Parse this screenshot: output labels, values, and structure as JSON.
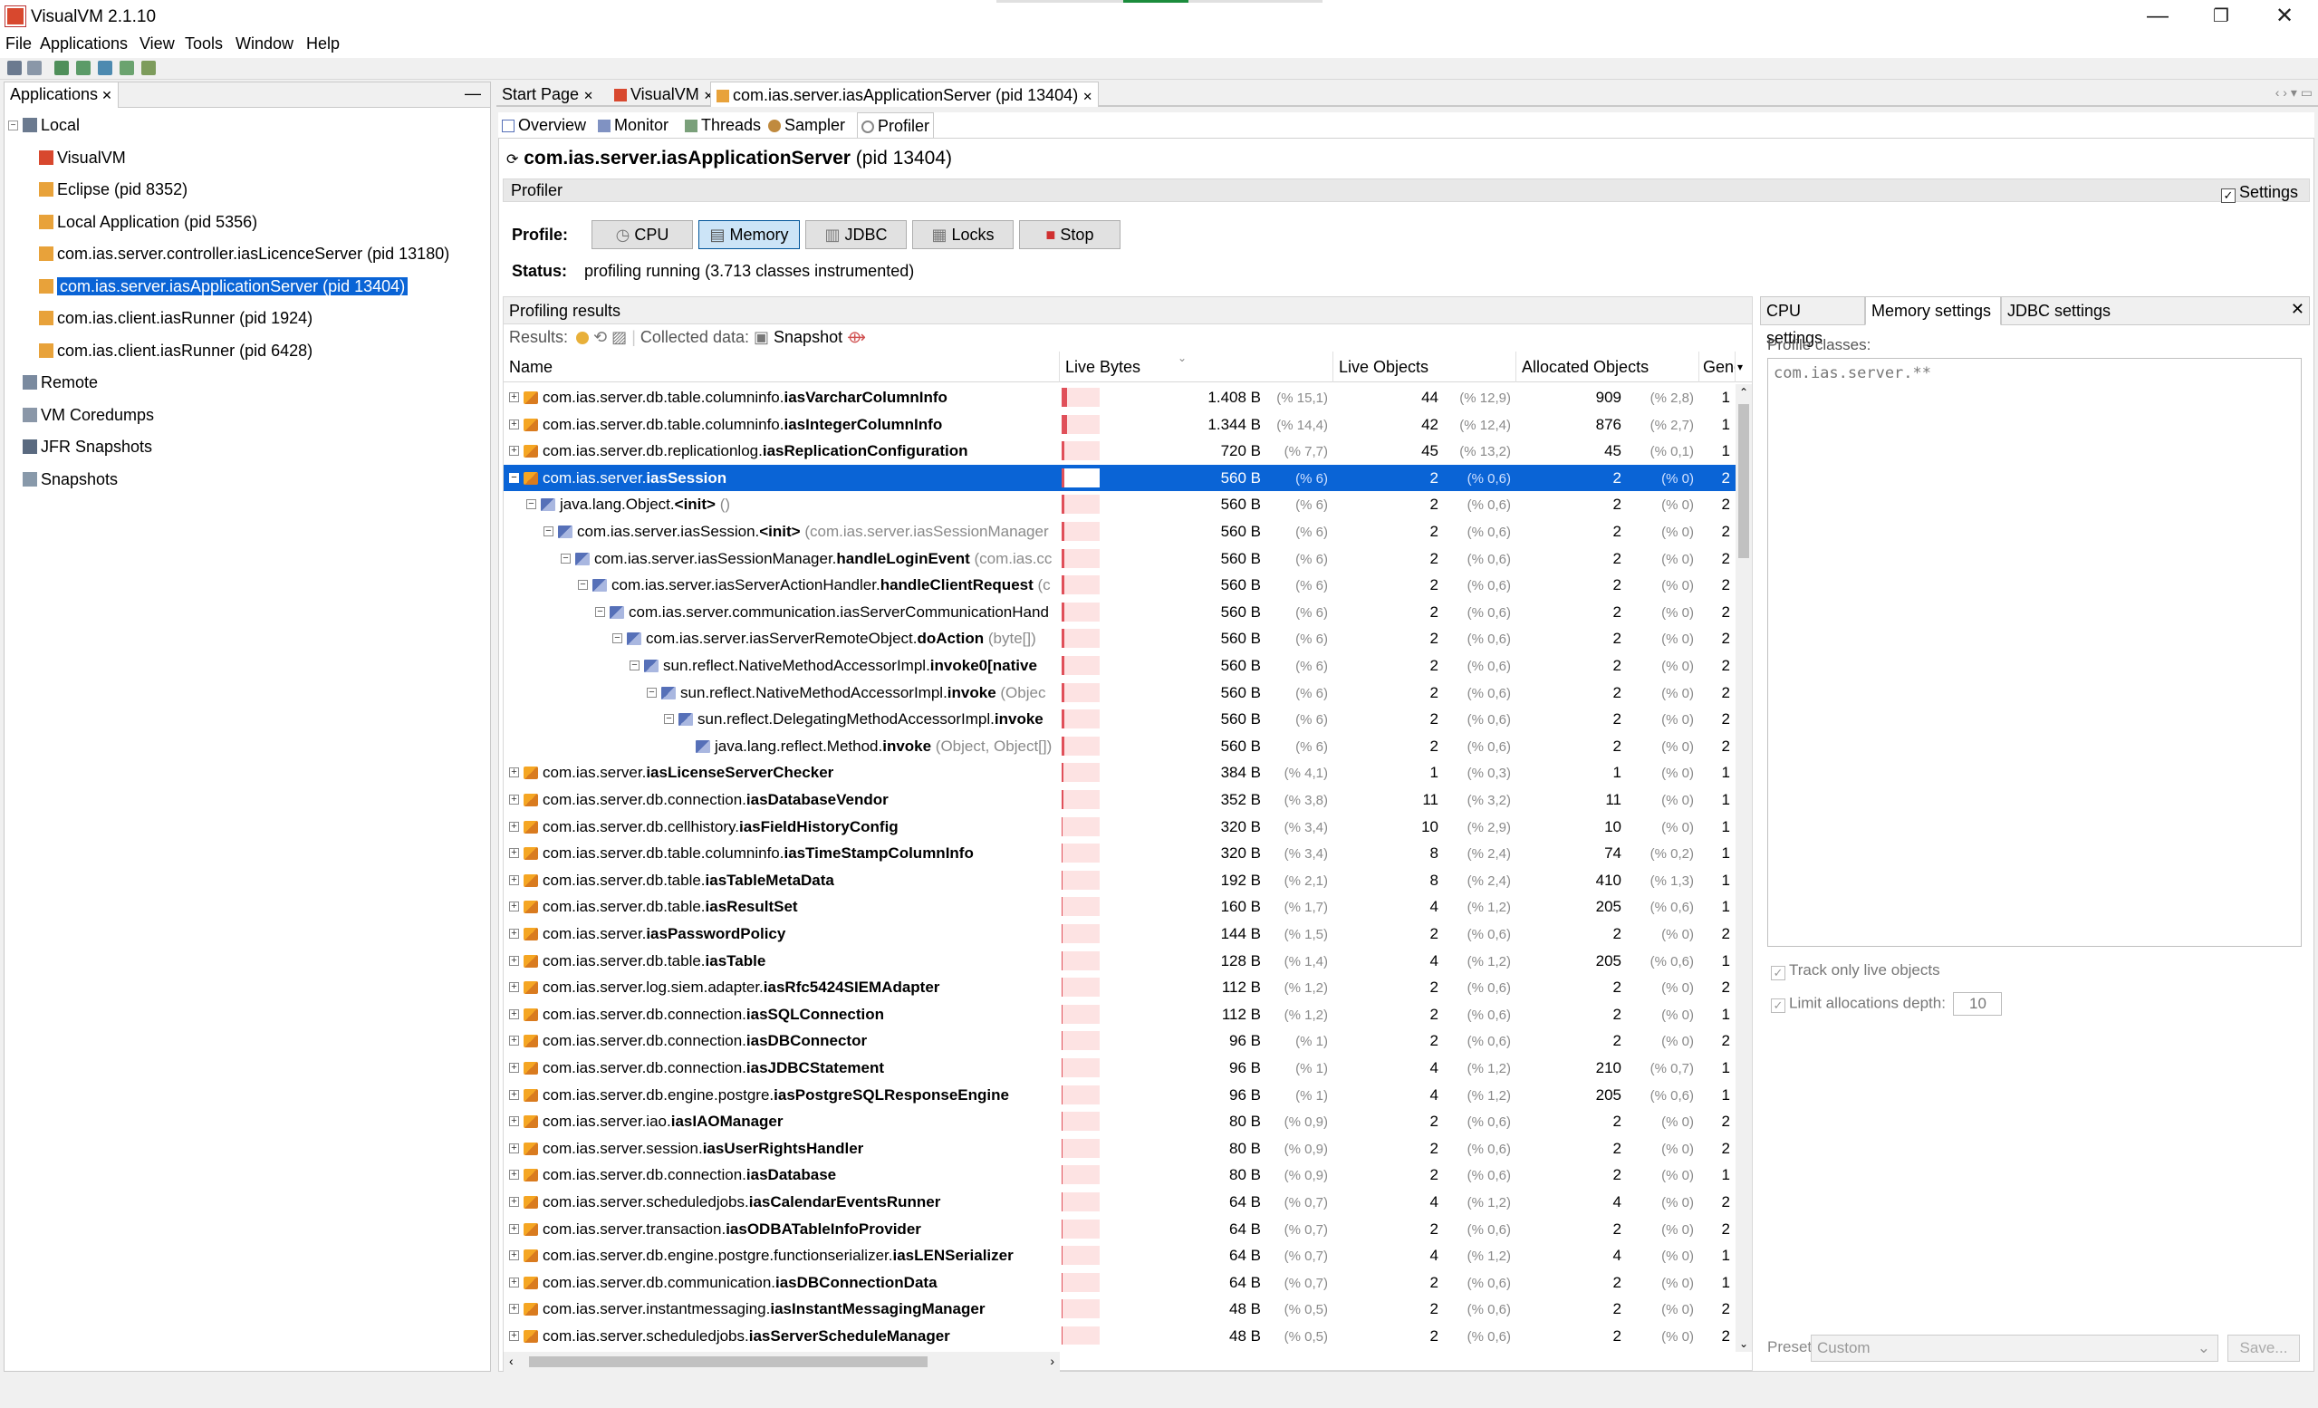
{
  "window": {
    "title": "VisualVM 2.1.10",
    "minimize": "—",
    "maximize": "❐",
    "close": "✕"
  },
  "menu": [
    "File",
    "Applications",
    "View",
    "Tools",
    "Window",
    "Help"
  ],
  "left_panel": {
    "tab": "Applications",
    "tree": [
      {
        "label": "Local",
        "level": 0,
        "icon": "computer-icon"
      },
      {
        "label": "VisualVM",
        "level": 1,
        "icon": "visualvm-icon"
      },
      {
        "label": "Eclipse (pid 8352)",
        "level": 1,
        "icon": "java-app-icon"
      },
      {
        "label": "Local Application (pid 5356)",
        "level": 1,
        "icon": "java-app-icon"
      },
      {
        "label": "com.ias.server.controller.iasLicenceServer (pid 13180)",
        "level": 1,
        "icon": "java-app-icon"
      },
      {
        "label": "com.ias.server.iasApplicationServer (pid 13404)",
        "level": 1,
        "icon": "java-app-icon",
        "selected": true
      },
      {
        "label": "com.ias.client.iasRunner (pid 1924)",
        "level": 1,
        "icon": "java-app-icon"
      },
      {
        "label": "com.ias.client.iasRunner (pid 6428)",
        "level": 1,
        "icon": "java-app-icon"
      },
      {
        "label": "Remote",
        "level": 0,
        "icon": "remote-icon"
      },
      {
        "label": "VM Coredumps",
        "level": 0,
        "icon": "coredump-icon"
      },
      {
        "label": "JFR Snapshots",
        "level": 0,
        "icon": "jfr-icon"
      },
      {
        "label": "Snapshots",
        "level": 0,
        "icon": "snapshot-icon"
      }
    ]
  },
  "doc_tabs": [
    {
      "label": "Start Page"
    },
    {
      "label": "VisualVM"
    },
    {
      "label": "com.ias.server.iasApplicationServer (pid 13404)",
      "active": true
    }
  ],
  "sub_tabs": [
    {
      "label": "Overview"
    },
    {
      "label": "Monitor"
    },
    {
      "label": "Threads"
    },
    {
      "label": "Sampler"
    },
    {
      "label": "Profiler",
      "active": true
    }
  ],
  "heading": {
    "name": "com.ias.server.iasApplicationServer",
    "pid": "(pid 13404)"
  },
  "profiler": {
    "section_title": "Profiler",
    "settings_label": "Settings",
    "settings_checked": true,
    "profile_label": "Profile:",
    "modes": [
      "CPU",
      "Memory",
      "JDBC",
      "Locks",
      "Stop"
    ],
    "active_mode": "Memory",
    "status_label": "Status:",
    "status_text": "profiling running (3.713 classes instrumented)"
  },
  "results": {
    "title": "Profiling results",
    "results_label": "Results:",
    "collected_label": "Collected data:",
    "snapshot_label": "Snapshot",
    "columns": [
      "Name",
      "Live Bytes",
      "Live Objects",
      "Allocated Objects",
      "Gener..."
    ],
    "rows": [
      {
        "depth": 0,
        "exp": "+",
        "icon": "class",
        "prefix": "com.ias.server.db.table.columninfo.",
        "bold": "iasVarcharColumnInfo",
        "extra": "",
        "bar": 0.151,
        "lb": "1.408 B",
        "lbp": "(% 15,1)",
        "lo": "44",
        "lop": "(% 12,9)",
        "ao": "909",
        "aop": "(% 2,8)",
        "gen": "1"
      },
      {
        "depth": 0,
        "exp": "+",
        "icon": "class",
        "prefix": "com.ias.server.db.table.columninfo.",
        "bold": "iasIntegerColumnInfo",
        "extra": "",
        "bar": 0.144,
        "lb": "1.344 B",
        "lbp": "(% 14,4)",
        "lo": "42",
        "lop": "(% 12,4)",
        "ao": "876",
        "aop": "(% 2,7)",
        "gen": "1"
      },
      {
        "depth": 0,
        "exp": "+",
        "icon": "class",
        "prefix": "com.ias.server.db.replicationlog.",
        "bold": "iasReplicationConfiguration",
        "extra": "",
        "bar": 0.077,
        "lb": "720 B",
        "lbp": "(% 7,7)",
        "lo": "45",
        "lop": "(% 13,2)",
        "ao": "45",
        "aop": "(% 0,1)",
        "gen": "1"
      },
      {
        "depth": 0,
        "exp": "−",
        "icon": "class",
        "prefix": "com.ias.server.",
        "bold": "iasSession",
        "extra": "",
        "bar": 0.06,
        "lb": "560 B",
        "lbp": "(% 6)",
        "lo": "2",
        "lop": "(% 0,6)",
        "ao": "2",
        "aop": "(% 0)",
        "gen": "2",
        "selected": true
      },
      {
        "depth": 1,
        "exp": "−",
        "icon": "method",
        "prefix": "java.lang.Object.",
        "bold": "<init>",
        "extra": " ()",
        "bar": 0.06,
        "lb": "560 B",
        "lbp": "(% 6)",
        "lo": "2",
        "lop": "(% 0,6)",
        "ao": "2",
        "aop": "(% 0)",
        "gen": "2"
      },
      {
        "depth": 2,
        "exp": "−",
        "icon": "method",
        "prefix": "com.ias.server.iasSession.",
        "bold": "<init>",
        "extra": " (com.ias.server.iasSessionManager",
        "bar": 0.06,
        "lb": "560 B",
        "lbp": "(% 6)",
        "lo": "2",
        "lop": "(% 0,6)",
        "ao": "2",
        "aop": "(% 0)",
        "gen": "2"
      },
      {
        "depth": 3,
        "exp": "−",
        "icon": "method",
        "prefix": "com.ias.server.iasSessionManager.",
        "bold": "handleLoginEvent",
        "extra": " (com.ias.cc",
        "bar": 0.06,
        "lb": "560 B",
        "lbp": "(% 6)",
        "lo": "2",
        "lop": "(% 0,6)",
        "ao": "2",
        "aop": "(% 0)",
        "gen": "2"
      },
      {
        "depth": 4,
        "exp": "−",
        "icon": "method",
        "prefix": "com.ias.server.iasServerActionHandler.",
        "bold": "handleClientRequest",
        "extra": " (c",
        "bar": 0.06,
        "lb": "560 B",
        "lbp": "(% 6)",
        "lo": "2",
        "lop": "(% 0,6)",
        "ao": "2",
        "aop": "(% 0)",
        "gen": "2"
      },
      {
        "depth": 5,
        "exp": "−",
        "icon": "method",
        "prefix": "com.ias.server.communication.iasServerCommunicationHand",
        "bold": "",
        "extra": "",
        "bar": 0.06,
        "lb": "560 B",
        "lbp": "(% 6)",
        "lo": "2",
        "lop": "(% 0,6)",
        "ao": "2",
        "aop": "(% 0)",
        "gen": "2"
      },
      {
        "depth": 6,
        "exp": "−",
        "icon": "method",
        "prefix": "com.ias.server.iasServerRemoteObject.",
        "bold": "doAction",
        "extra": " (byte[])",
        "bar": 0.06,
        "lb": "560 B",
        "lbp": "(% 6)",
        "lo": "2",
        "lop": "(% 0,6)",
        "ao": "2",
        "aop": "(% 0)",
        "gen": "2"
      },
      {
        "depth": 7,
        "exp": "−",
        "icon": "method",
        "prefix": "sun.reflect.NativeMethodAccessorImpl.",
        "bold": "invoke0[native",
        "extra": "",
        "bar": 0.06,
        "lb": "560 B",
        "lbp": "(% 6)",
        "lo": "2",
        "lop": "(% 0,6)",
        "ao": "2",
        "aop": "(% 0)",
        "gen": "2"
      },
      {
        "depth": 8,
        "exp": "−",
        "icon": "method",
        "prefix": "sun.reflect.NativeMethodAccessorImpl.",
        "bold": "invoke",
        "extra": " (Objec",
        "bar": 0.06,
        "lb": "560 B",
        "lbp": "(% 6)",
        "lo": "2",
        "lop": "(% 0,6)",
        "ao": "2",
        "aop": "(% 0)",
        "gen": "2"
      },
      {
        "depth": 9,
        "exp": "−",
        "icon": "method",
        "prefix": "sun.reflect.DelegatingMethodAccessorImpl.",
        "bold": "invoke",
        "extra": "",
        "bar": 0.06,
        "lb": "560 B",
        "lbp": "(% 6)",
        "lo": "2",
        "lop": "(% 0,6)",
        "ao": "2",
        "aop": "(% 0)",
        "gen": "2"
      },
      {
        "depth": 10,
        "exp": "",
        "icon": "method",
        "prefix": "java.lang.reflect.Method.",
        "bold": "invoke",
        "extra": " (Object, Object[])",
        "bar": 0.06,
        "lb": "560 B",
        "lbp": "(% 6)",
        "lo": "2",
        "lop": "(% 0,6)",
        "ao": "2",
        "aop": "(% 0)",
        "gen": "2"
      },
      {
        "depth": 0,
        "exp": "+",
        "icon": "class",
        "prefix": "com.ias.server.",
        "bold": "iasLicenseServerChecker",
        "extra": "",
        "bar": 0.041,
        "lb": "384 B",
        "lbp": "(% 4,1)",
        "lo": "1",
        "lop": "(% 0,3)",
        "ao": "1",
        "aop": "(% 0)",
        "gen": "1"
      },
      {
        "depth": 0,
        "exp": "+",
        "icon": "class",
        "prefix": "com.ias.server.db.connection.",
        "bold": "iasDatabaseVendor",
        "extra": "",
        "bar": 0.038,
        "lb": "352 B",
        "lbp": "(% 3,8)",
        "lo": "11",
        "lop": "(% 3,2)",
        "ao": "11",
        "aop": "(% 0)",
        "gen": "1"
      },
      {
        "depth": 0,
        "exp": "+",
        "icon": "class",
        "prefix": "com.ias.server.db.cellhistory.",
        "bold": "iasFieldHistoryConfig",
        "extra": "",
        "bar": 0.034,
        "lb": "320 B",
        "lbp": "(% 3,4)",
        "lo": "10",
        "lop": "(% 2,9)",
        "ao": "10",
        "aop": "(% 0)",
        "gen": "1"
      },
      {
        "depth": 0,
        "exp": "+",
        "icon": "class",
        "prefix": "com.ias.server.db.table.columninfo.",
        "bold": "iasTimeStampColumnInfo",
        "extra": "",
        "bar": 0.034,
        "lb": "320 B",
        "lbp": "(% 3,4)",
        "lo": "8",
        "lop": "(% 2,4)",
        "ao": "74",
        "aop": "(% 0,2)",
        "gen": "1"
      },
      {
        "depth": 0,
        "exp": "+",
        "icon": "class",
        "prefix": "com.ias.server.db.table.",
        "bold": "iasTableMetaData",
        "extra": "",
        "bar": 0.021,
        "lb": "192 B",
        "lbp": "(% 2,1)",
        "lo": "8",
        "lop": "(% 2,4)",
        "ao": "410",
        "aop": "(% 1,3)",
        "gen": "1"
      },
      {
        "depth": 0,
        "exp": "+",
        "icon": "class",
        "prefix": "com.ias.server.db.table.",
        "bold": "iasResultSet",
        "extra": "",
        "bar": 0.017,
        "lb": "160 B",
        "lbp": "(% 1,7)",
        "lo": "4",
        "lop": "(% 1,2)",
        "ao": "205",
        "aop": "(% 0,6)",
        "gen": "1"
      },
      {
        "depth": 0,
        "exp": "+",
        "icon": "class",
        "prefix": "com.ias.server.",
        "bold": "iasPasswordPolicy",
        "extra": "",
        "bar": 0.015,
        "lb": "144 B",
        "lbp": "(% 1,5)",
        "lo": "2",
        "lop": "(% 0,6)",
        "ao": "2",
        "aop": "(% 0)",
        "gen": "2"
      },
      {
        "depth": 0,
        "exp": "+",
        "icon": "class",
        "prefix": "com.ias.server.db.table.",
        "bold": "iasTable",
        "extra": "",
        "bar": 0.014,
        "lb": "128 B",
        "lbp": "(% 1,4)",
        "lo": "4",
        "lop": "(% 1,2)",
        "ao": "205",
        "aop": "(% 0,6)",
        "gen": "1"
      },
      {
        "depth": 0,
        "exp": "+",
        "icon": "class",
        "prefix": "com.ias.server.log.siem.adapter.",
        "bold": "iasRfc5424SIEMAdapter",
        "extra": "",
        "bar": 0.012,
        "lb": "112 B",
        "lbp": "(% 1,2)",
        "lo": "2",
        "lop": "(% 0,6)",
        "ao": "2",
        "aop": "(% 0)",
        "gen": "2"
      },
      {
        "depth": 0,
        "exp": "+",
        "icon": "class",
        "prefix": "com.ias.server.db.connection.",
        "bold": "iasSQLConnection",
        "extra": "",
        "bar": 0.012,
        "lb": "112 B",
        "lbp": "(% 1,2)",
        "lo": "2",
        "lop": "(% 0,6)",
        "ao": "2",
        "aop": "(% 0)",
        "gen": "1"
      },
      {
        "depth": 0,
        "exp": "+",
        "icon": "class",
        "prefix": "com.ias.server.db.connection.",
        "bold": "iasDBConnector",
        "extra": "",
        "bar": 0.01,
        "lb": "96 B",
        "lbp": "(% 1)",
        "lo": "2",
        "lop": "(% 0,6)",
        "ao": "2",
        "aop": "(% 0)",
        "gen": "2"
      },
      {
        "depth": 0,
        "exp": "+",
        "icon": "class",
        "prefix": "com.ias.server.db.connection.",
        "bold": "iasJDBCStatement",
        "extra": "",
        "bar": 0.01,
        "lb": "96 B",
        "lbp": "(% 1)",
        "lo": "4",
        "lop": "(% 1,2)",
        "ao": "210",
        "aop": "(% 0,7)",
        "gen": "1"
      },
      {
        "depth": 0,
        "exp": "+",
        "icon": "class",
        "prefix": "com.ias.server.db.engine.postgre.",
        "bold": "iasPostgreSQLResponseEngine",
        "extra": "",
        "bar": 0.01,
        "lb": "96 B",
        "lbp": "(% 1)",
        "lo": "4",
        "lop": "(% 1,2)",
        "ao": "205",
        "aop": "(% 0,6)",
        "gen": "1"
      },
      {
        "depth": 0,
        "exp": "+",
        "icon": "class",
        "prefix": "com.ias.server.iao.",
        "bold": "iasIAOManager",
        "extra": "",
        "bar": 0.009,
        "lb": "80 B",
        "lbp": "(% 0,9)",
        "lo": "2",
        "lop": "(% 0,6)",
        "ao": "2",
        "aop": "(% 0)",
        "gen": "2"
      },
      {
        "depth": 0,
        "exp": "+",
        "icon": "class",
        "prefix": "com.ias.server.session.",
        "bold": "iasUserRightsHandler",
        "extra": "",
        "bar": 0.009,
        "lb": "80 B",
        "lbp": "(% 0,9)",
        "lo": "2",
        "lop": "(% 0,6)",
        "ao": "2",
        "aop": "(% 0)",
        "gen": "2"
      },
      {
        "depth": 0,
        "exp": "+",
        "icon": "class",
        "prefix": "com.ias.server.db.connection.",
        "bold": "iasDatabase",
        "extra": "",
        "bar": 0.009,
        "lb": "80 B",
        "lbp": "(% 0,9)",
        "lo": "2",
        "lop": "(% 0,6)",
        "ao": "2",
        "aop": "(% 0)",
        "gen": "1"
      },
      {
        "depth": 0,
        "exp": "+",
        "icon": "class",
        "prefix": "com.ias.server.scheduledjobs.",
        "bold": "iasCalendarEventsRunner",
        "extra": "",
        "bar": 0.007,
        "lb": "64 B",
        "lbp": "(% 0,7)",
        "lo": "4",
        "lop": "(% 1,2)",
        "ao": "4",
        "aop": "(% 0)",
        "gen": "2"
      },
      {
        "depth": 0,
        "exp": "+",
        "icon": "class",
        "prefix": "com.ias.server.transaction.",
        "bold": "iasODBATableInfoProvider",
        "extra": "",
        "bar": 0.007,
        "lb": "64 B",
        "lbp": "(% 0,7)",
        "lo": "2",
        "lop": "(% 0,6)",
        "ao": "2",
        "aop": "(% 0)",
        "gen": "2"
      },
      {
        "depth": 0,
        "exp": "+",
        "icon": "class",
        "prefix": "com.ias.server.db.engine.postgre.functionserializer.",
        "bold": "iasLENSerializer",
        "extra": "",
        "bar": 0.007,
        "lb": "64 B",
        "lbp": "(% 0,7)",
        "lo": "4",
        "lop": "(% 1,2)",
        "ao": "4",
        "aop": "(% 0)",
        "gen": "1"
      },
      {
        "depth": 0,
        "exp": "+",
        "icon": "class",
        "prefix": "com.ias.server.db.communication.",
        "bold": "iasDBConnectionData",
        "extra": "",
        "bar": 0.007,
        "lb": "64 B",
        "lbp": "(% 0,7)",
        "lo": "2",
        "lop": "(% 0,6)",
        "ao": "2",
        "aop": "(% 0)",
        "gen": "1"
      },
      {
        "depth": 0,
        "exp": "+",
        "icon": "class",
        "prefix": "com.ias.server.instantmessaging.",
        "bold": "iasInstantMessagingManager",
        "extra": "",
        "bar": 0.005,
        "lb": "48 B",
        "lbp": "(% 0,5)",
        "lo": "2",
        "lop": "(% 0,6)",
        "ao": "2",
        "aop": "(% 0)",
        "gen": "2"
      },
      {
        "depth": 0,
        "exp": "+",
        "icon": "class",
        "prefix": "com.ias.server.scheduledjobs.",
        "bold": "iasServerScheduleManager",
        "extra": "",
        "bar": 0.005,
        "lb": "48 B",
        "lbp": "(% 0,5)",
        "lo": "2",
        "lop": "(% 0,6)",
        "ao": "2",
        "aop": "(% 0)",
        "gen": "2"
      }
    ]
  },
  "settings_panel": {
    "tabs": [
      "CPU settings",
      "Memory settings",
      "JDBC settings"
    ],
    "active_tab": "Memory settings",
    "profile_classes_label": "Profile classes:",
    "profile_classes_value": "com.ias.server.**",
    "track_live_label": "Track only live objects",
    "limit_depth_label": "Limit allocations depth:",
    "limit_depth_value": "10",
    "preset_label": "Preset:",
    "preset_value": "Custom",
    "save_label": "Save..."
  },
  "colors": {
    "selection": "#0a64d6",
    "bar": "#e0505a",
    "bar_bg": "#fde3e3"
  }
}
